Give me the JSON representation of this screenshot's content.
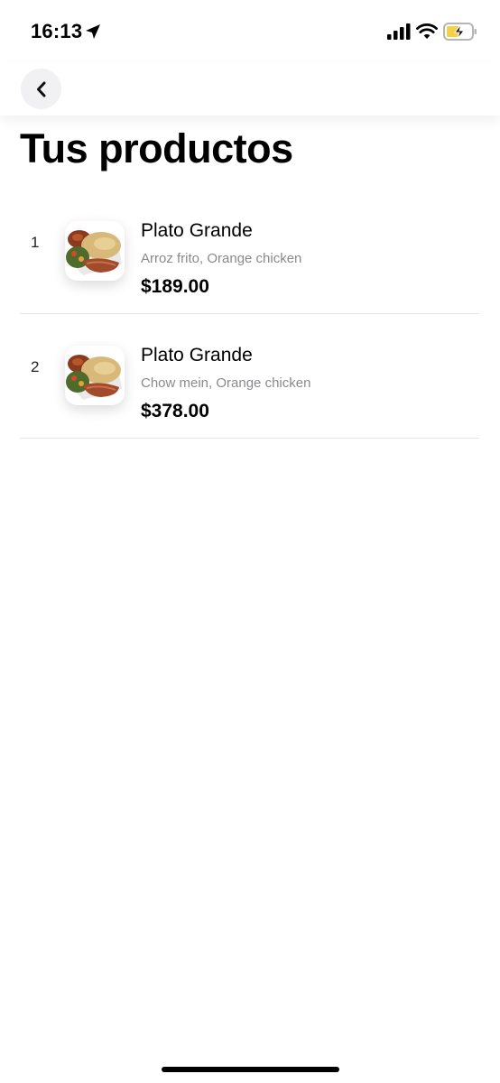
{
  "status_bar": {
    "time": "16:13",
    "icons": [
      "location-arrow-icon",
      "cellular-signal-icon",
      "wifi-icon",
      "battery-charging-icon"
    ],
    "battery_color": "#f7d046"
  },
  "nav": {
    "back_icon": "chevron-left-icon"
  },
  "page": {
    "title": "Tus productos"
  },
  "products": [
    {
      "index": "1",
      "name": "Plato Grande",
      "description": "Arroz frito, Orange chicken",
      "price": "$189.00",
      "image_icon": "food-plate-icon"
    },
    {
      "index": "2",
      "name": "Plato Grande",
      "description": "Chow mein, Orange chicken",
      "price": "$378.00",
      "image_icon": "food-plate-icon"
    }
  ]
}
